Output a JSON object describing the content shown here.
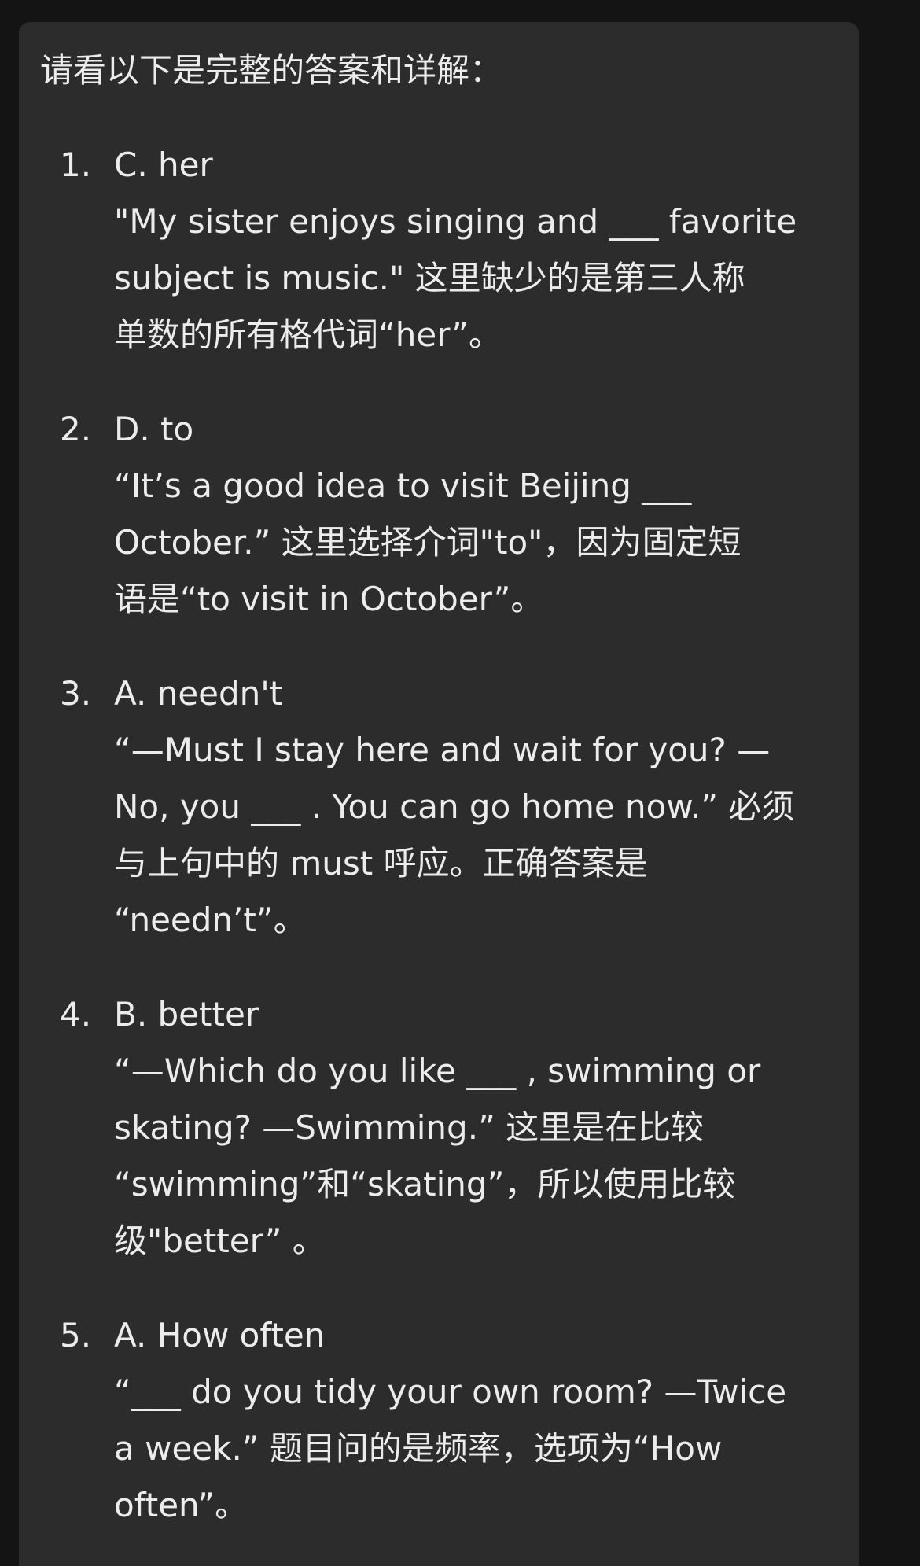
{
  "intro": "请看以下是完整的答案和详解：",
  "answers": [
    {
      "number": "1.",
      "choice": "C. her",
      "lines": [
        "\"My sister enjoys singing and ___ favorite",
        "subject is music.\" 这里缺少的是第三人称",
        "单数的所有格代词“her”。"
      ]
    },
    {
      "number": "2.",
      "choice": "D. to",
      "lines": [
        "“It’s a good idea to visit Beijing ___",
        "October.” 这里选择介词\"to\"，因为固定短",
        "语是“to visit in October”。"
      ]
    },
    {
      "number": "3.",
      "choice": "A. needn't",
      "lines": [
        "“—Must I stay here and wait for you? —",
        "No, you ___ . You can go home now.” 必须",
        "与上句中的 must 呼应。正确答案是",
        "“needn’t”。"
      ]
    },
    {
      "number": "4.",
      "choice": "B. better",
      "lines": [
        "“—Which do you like ___ , swimming or",
        "skating? —Swimming.” 这里是在比较",
        "“swimming”和“skating”，所以使用比较",
        "级\"better”  。"
      ]
    },
    {
      "number": "5.",
      "choice": "A. How often",
      "lines": [
        "“___ do you tidy your own room? —Twice",
        "a week.” 题目问的是频率，选项为“How",
        "often”。"
      ]
    }
  ]
}
